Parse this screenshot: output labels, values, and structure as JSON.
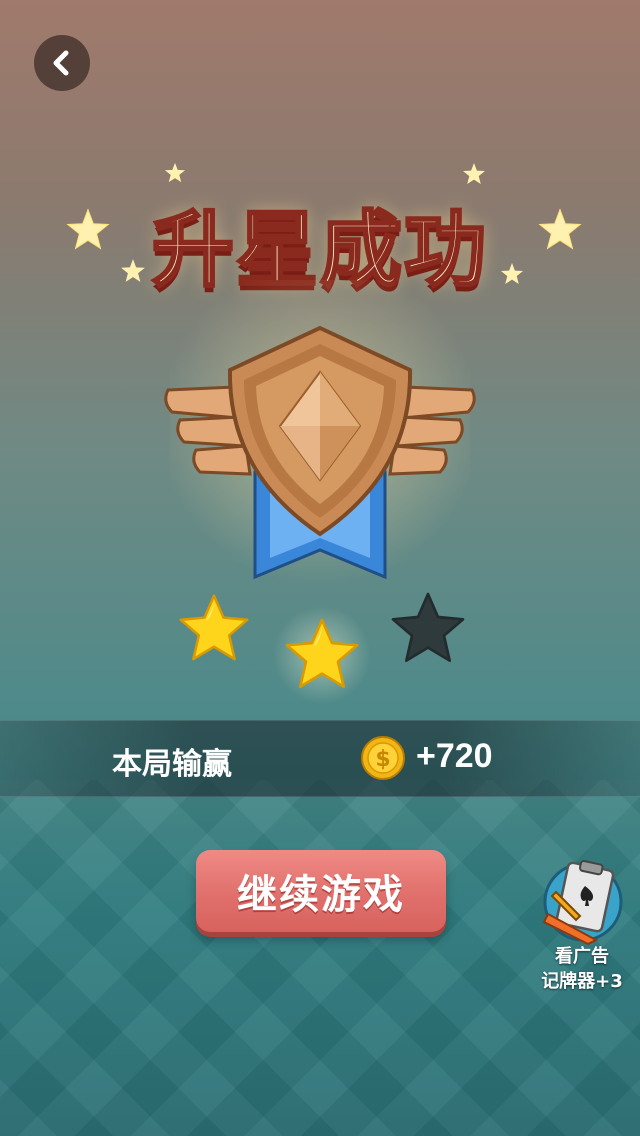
{
  "header": {
    "back_icon": "chevron-left-icon",
    "title": "升星成功"
  },
  "badge": {
    "icon": "bronze-winged-shield-badge",
    "colors": {
      "bronze": "#c98a55",
      "ribbon": "#3a86d9"
    }
  },
  "stars": {
    "earned": 2,
    "total": 3,
    "colors": {
      "filled": "#ffd51c",
      "empty": "#2e3a3c"
    }
  },
  "result": {
    "label": "本局输赢",
    "coin_icon": "gold-coin-icon",
    "value": "+720"
  },
  "actions": {
    "continue_label": "继续游戏",
    "ad_line1": "看广告",
    "ad_line2": "记牌器+3",
    "ad_icon": "card-counter-clipboard-icon"
  },
  "colors": {
    "button": "#e0706c",
    "title_fill": "#fff7d6",
    "title_stroke": "#8a2a1e"
  }
}
